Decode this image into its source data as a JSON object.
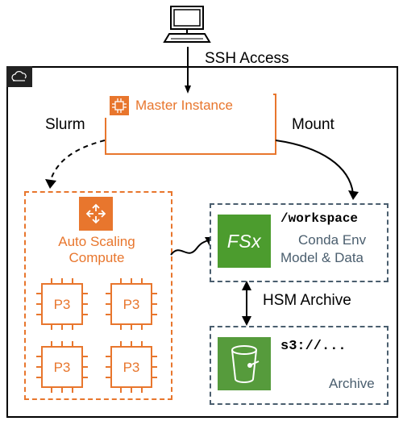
{
  "labels": {
    "ssh": "SSH Access",
    "slurm": "Slurm",
    "mount": "Mount",
    "hsm": "HSM Archive",
    "master": "Master Instance",
    "autoscaling_line1": "Auto Scaling",
    "autoscaling_line2": "Compute",
    "p3": "P3",
    "workspace": "/workspace",
    "conda": "Conda Env",
    "modeldata": "Model & Data",
    "s3": "s3://...",
    "archive": "Archive",
    "fsx": "FSx"
  },
  "colors": {
    "orange": "#e8762d",
    "green": "#4c9c2e",
    "slate": "#4a5e6e",
    "s3green": "#569b3c"
  }
}
